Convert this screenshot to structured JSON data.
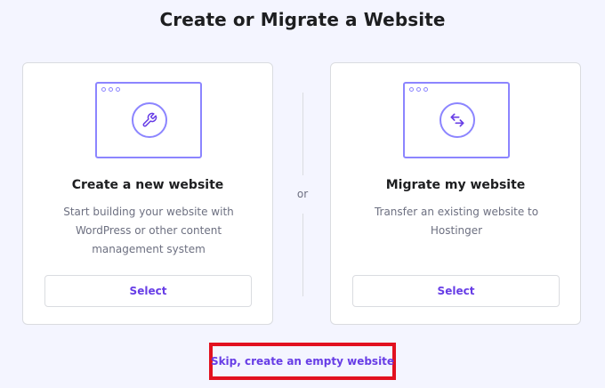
{
  "page": {
    "title": "Create or Migrate a Website",
    "divider_label": "or",
    "skip_link": "Skip, create an empty website"
  },
  "cards": [
    {
      "title": "Create a new website",
      "description": "Start building your website with WordPress or other content management system",
      "button": "Select",
      "icon": "wrench-icon"
    },
    {
      "title": "Migrate my website",
      "description": "Transfer an existing website to Hostinger",
      "button": "Select",
      "icon": "transfer-arrows-icon"
    }
  ],
  "colors": {
    "background": "#f4f5ff",
    "accent": "#673de6",
    "illustration": "#8c85ff",
    "highlight_box": "#e2111f",
    "text_primary": "#1d1e20",
    "text_secondary": "#6d7081"
  }
}
